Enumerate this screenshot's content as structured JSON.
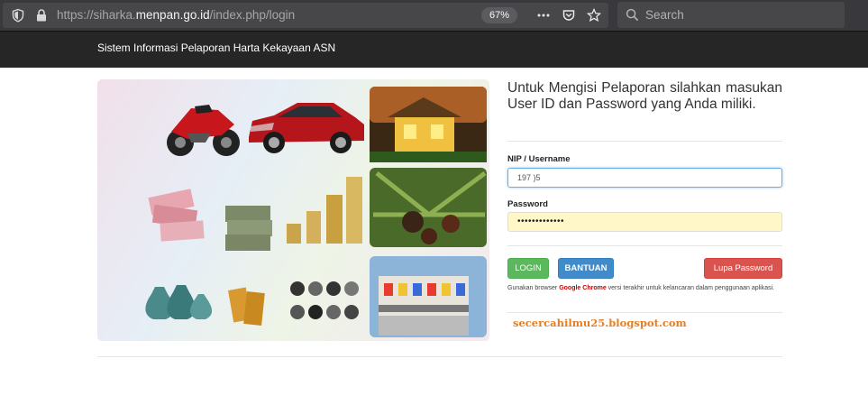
{
  "browser": {
    "url_prefix": "https://siharka.",
    "url_domain": "menpan.go.id",
    "url_path": "/index.php/login",
    "zoom": "67%",
    "search_placeholder": "Search"
  },
  "header": {
    "title": "Sistem Informasi Pelaporan Harta Kekayaan ASN"
  },
  "banner": {
    "icons": [
      "motorcycle-icon",
      "car-icon",
      "house-icon",
      "money-icon",
      "coins-icon",
      "palm-oil-icon",
      "vase-icon",
      "gold-bar-icon",
      "watch-icon",
      "building-icon"
    ]
  },
  "login": {
    "intro": "Untuk Mengisi Pelaporan silahkan masukan User ID dan Password yang Anda miliki.",
    "username_label": "NIP / Username",
    "username_value": "197                         )5",
    "password_label": "Password",
    "password_value": "•••••••••••••",
    "login_button": "LOGIN",
    "help_button": "BANTUAN",
    "forgot_button": "Lupa Password",
    "note_prefix": "Gunakan browser ",
    "note_chrome": "Google Chrome",
    "note_suffix": " versi terakhir untuk kelancaran dalam penggunaan aplikasi."
  },
  "watermark": "secercahilmu25.blogspot.com",
  "colors": {
    "login": "#5cb85c",
    "help": "#428bca",
    "forgot": "#d9534f",
    "watermark": "#e67e22"
  }
}
